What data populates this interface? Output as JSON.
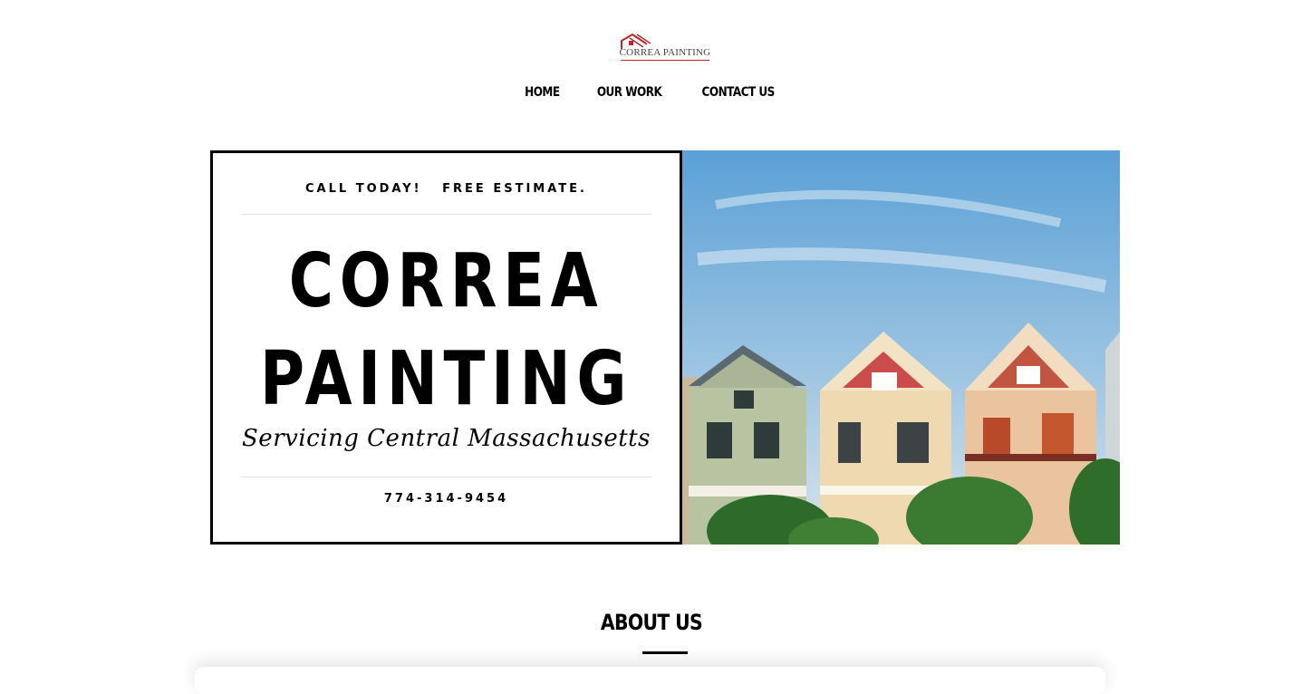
{
  "brand": {
    "logo_text": "CORREA PAINTING",
    "accent": "#c0272d"
  },
  "nav": {
    "items": [
      {
        "label": "HOME"
      },
      {
        "label": "OUR WORK"
      },
      {
        "label": "CONTACT US"
      }
    ]
  },
  "hero": {
    "tagline": "CALL TODAY!   FREE ESTIMATE.",
    "title_line1": "CORREA",
    "title_line2": "PAINTING",
    "subtitle": "Servicing Central Massachusetts",
    "phone": "774-314-9454",
    "image_subject": "row of painted victorian houses under blue sky"
  },
  "about": {
    "heading": "ABOUT US"
  }
}
